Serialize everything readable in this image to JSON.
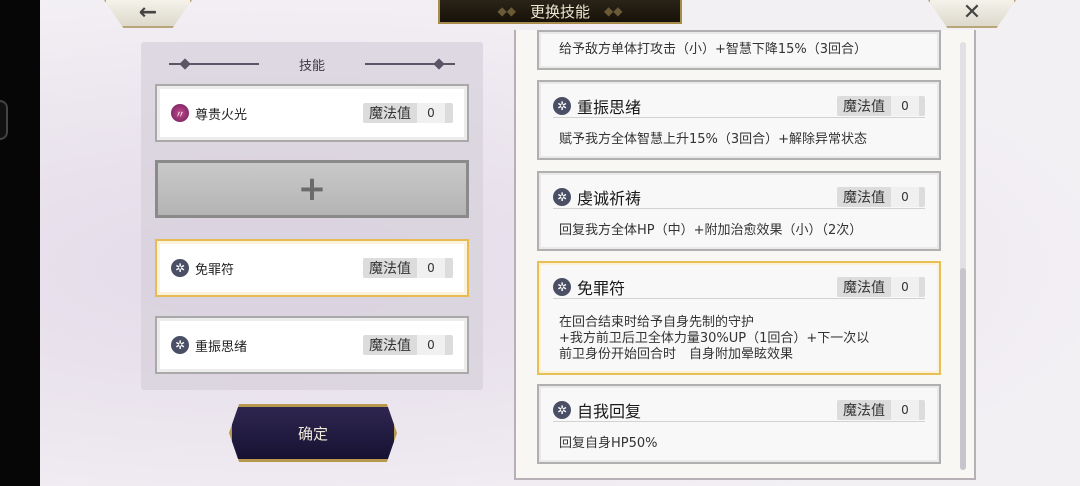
{
  "title": "更换技能",
  "nav": {
    "back_glyph": "←",
    "close_glyph": "✕"
  },
  "left_panel": {
    "header": "技能",
    "mana_label": "魔法值",
    "equipped": [
      {
        "name": "尊贵火光",
        "mana": "0",
        "icon": "fire-icon"
      },
      {
        "name": "免罪符",
        "mana": "0",
        "icon": "gear-icon"
      },
      {
        "name": "重振思绪",
        "mana": "0",
        "icon": "gear-icon"
      }
    ],
    "empty_slot_glyph": "+"
  },
  "confirm_label": "确定",
  "skill_list": {
    "mana_label": "魔法值",
    "partial_top_desc": "给予敌方单体打攻击（小）+智慧下降15%（3回合）",
    "items": [
      {
        "name": "重振思绪",
        "mana": "0",
        "desc": "赋予我方全体智慧上升15%（3回合）+解除异常状态"
      },
      {
        "name": "虔诚祈祷",
        "mana": "0",
        "desc": "回复我方全体HP（中）+附加治愈效果（小）（2次）"
      },
      {
        "name": "免罪符",
        "mana": "0",
        "desc_lines": [
          "在回合结束时给予自身先制的守护",
          "+我方前卫后卫全体力量30%UP（1回合）+下一次以",
          "前卫身份开始回合时　自身附加晕眩效果"
        ]
      },
      {
        "name": "自我回复",
        "mana": "0",
        "desc": "回复自身HP50%"
      }
    ]
  }
}
